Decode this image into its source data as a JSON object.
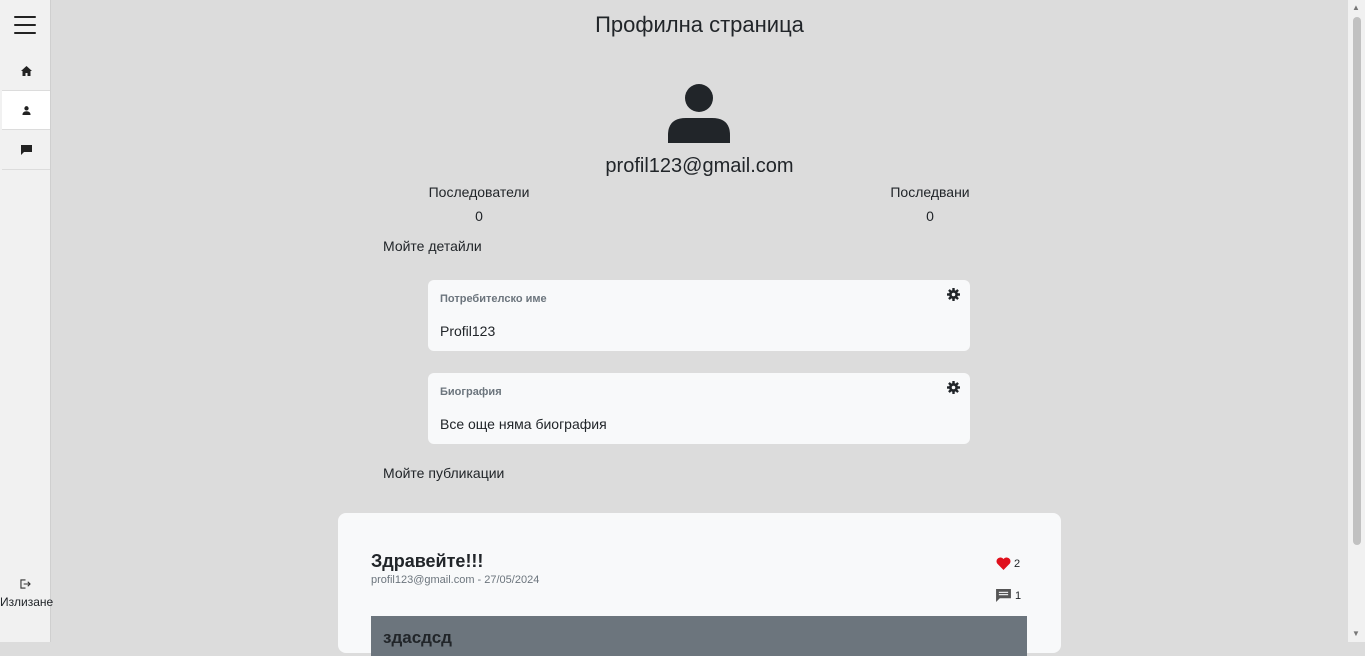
{
  "sidebar": {
    "logout_label": "Излизане"
  },
  "page": {
    "title": "Профилна страница",
    "email": "profil123@gmail.com"
  },
  "stats": {
    "followers_label": "Последователи",
    "followers_count": "0",
    "following_label": "Последвани",
    "following_count": "0"
  },
  "details": {
    "section_label": "Мойте детайли",
    "username_label": "Потребителско име",
    "username_value": "Profil123",
    "bio_label": "Биография",
    "bio_value": "Все още няма биография"
  },
  "posts": {
    "section_label": "Мойте публикации",
    "items": [
      {
        "title": "Здравейте!!!",
        "meta": "profil123@gmail.com - 27/05/2024",
        "likes": "2",
        "comments": "1",
        "image_text": "здасдсд"
      }
    ]
  },
  "colors": {
    "background": "#dcdcdc",
    "card": "#f8f9fa",
    "heart": "#e0101c",
    "muted": "#6c757d"
  }
}
